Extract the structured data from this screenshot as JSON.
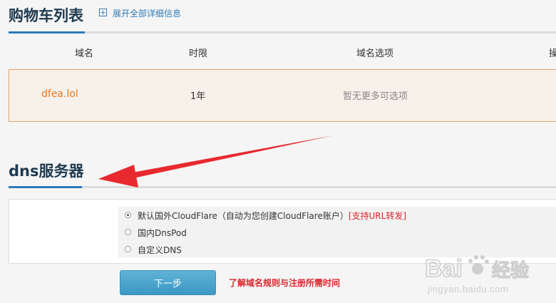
{
  "cart": {
    "title": "购物车列表",
    "expand_label": "展开全部详细信息",
    "columns": [
      "域名",
      "时限",
      "域名选项",
      "操"
    ],
    "rows": [
      {
        "domain": "dfea.lol",
        "term": "1年",
        "options": "暂无更多可选项"
      }
    ]
  },
  "dns": {
    "title": "dns服务器",
    "options": [
      {
        "label": "默认国外CloudFlare（自动为您创建CloudFlare账户）",
        "tag": "[支持URL转发]",
        "selected": true
      },
      {
        "label": "国内DnsPod",
        "tag": "",
        "selected": false
      },
      {
        "label": "自定义DNS",
        "tag": "",
        "selected": false
      }
    ]
  },
  "actions": {
    "next_label": "下一步",
    "rules_link": "了解域名规则与注册所需时间"
  },
  "watermark": {
    "brand": "Baidu经验",
    "url": "jingyan.baidu.com"
  },
  "colors": {
    "accent_blue": "#2e7ab8",
    "domain_orange": "#e87722",
    "arrow_red": "#e8292f",
    "link_red": "#d9262c"
  }
}
